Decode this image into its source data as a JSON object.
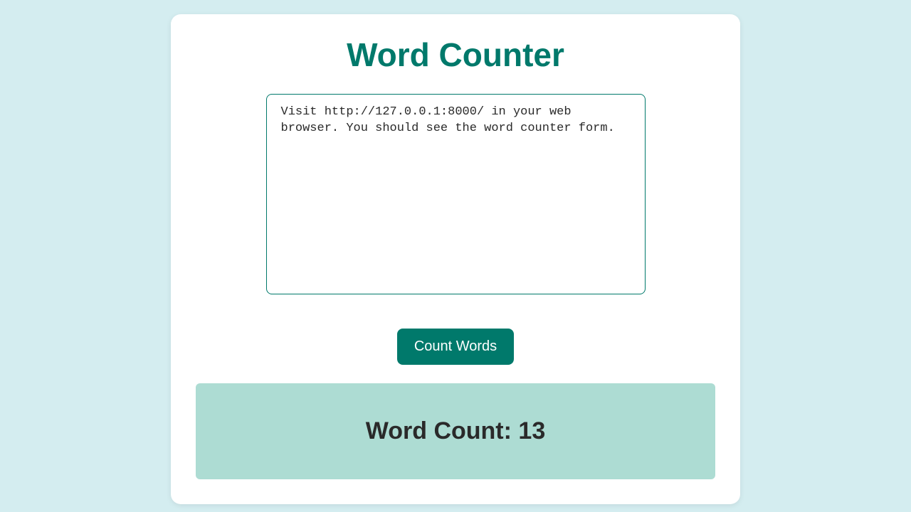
{
  "header": {
    "title": "Word Counter"
  },
  "input": {
    "value": "Visit http://127.0.0.1:8000/ in your web browser. You should see the word counter form."
  },
  "action": {
    "count_label": "Count Words"
  },
  "result": {
    "label_prefix": "Word Count: ",
    "count": "13"
  }
}
